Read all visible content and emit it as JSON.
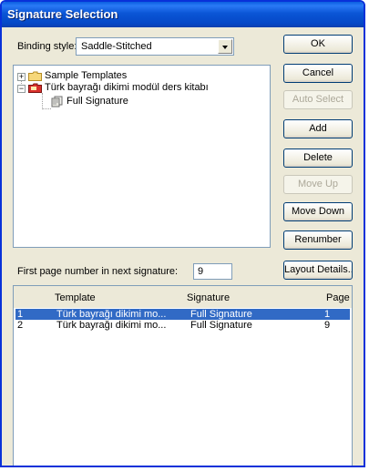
{
  "window": {
    "title": "Signature Selection"
  },
  "binding": {
    "label": "Binding style:",
    "value": "Saddle-Stitched"
  },
  "tree": {
    "items": [
      {
        "label": "Sample Templates",
        "icon": "folder-icon"
      },
      {
        "label": "Türk bayrağı dikimi modül ders kitabı",
        "icon": "template-icon"
      },
      {
        "label": "Full Signature",
        "icon": "signature-icon"
      }
    ]
  },
  "buttons": {
    "ok": "OK",
    "cancel": "Cancel",
    "auto_select": "Auto Select",
    "add": "Add",
    "delete": "Delete",
    "move_up": "Move Up",
    "move_down": "Move Down",
    "renumber": "Renumber",
    "layout_details": "Layout Details..."
  },
  "first_page": {
    "label": "First page number in next signature:",
    "value": "9"
  },
  "table": {
    "headers": {
      "template": "Template",
      "signature": "Signature",
      "page": "Page"
    },
    "rows": [
      {
        "index": "1",
        "template": "Türk bayrağı dikimi mo...",
        "signature": "Full Signature",
        "page": "1"
      },
      {
        "index": "2",
        "template": "Türk bayrağı dikimi mo...",
        "signature": "Full Signature",
        "page": "9"
      }
    ]
  },
  "colors": {
    "title_bar": "#0a55d6",
    "selection": "#316ac5",
    "dialog_bg": "#ece9d8"
  }
}
